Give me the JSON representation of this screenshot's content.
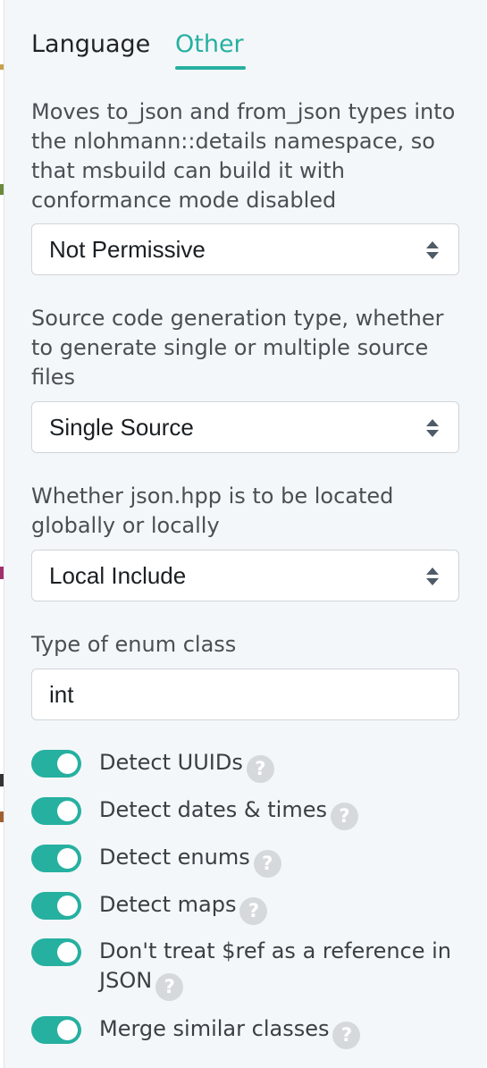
{
  "tabs": [
    {
      "label": "Language",
      "active": false
    },
    {
      "label": "Other",
      "active": true
    }
  ],
  "accent_color": "#26b0a0",
  "settings": {
    "permissive": {
      "description": "Moves to_json and from_json types into the nlohmann::details namespace, so that msbuild can build it with conformance mode disabled",
      "value": "Not Permissive"
    },
    "source_style": {
      "description": "Source code generation type, whether to generate single or multiple source files",
      "value": "Single Source"
    },
    "include_location": {
      "description": "Whether json.hpp is to be located globally or locally",
      "value": "Local Include"
    },
    "enum_type": {
      "label": "Type of enum class",
      "value": "int"
    }
  },
  "toggles": [
    {
      "label": "Detect UUIDs",
      "on": true,
      "help_icon": "question-icon"
    },
    {
      "label": "Detect dates & times",
      "on": true,
      "help_icon": "question-icon"
    },
    {
      "label": "Detect enums",
      "on": true,
      "help_icon": "question-icon"
    },
    {
      "label": "Detect maps",
      "on": true,
      "help_icon": "question-icon"
    },
    {
      "label": "Don't treat $ref as a reference in JSON",
      "on": true,
      "help_icon": "question-icon"
    },
    {
      "label": "Merge similar classes",
      "on": true,
      "help_icon": "question-icon"
    }
  ],
  "help_glyph": "?"
}
